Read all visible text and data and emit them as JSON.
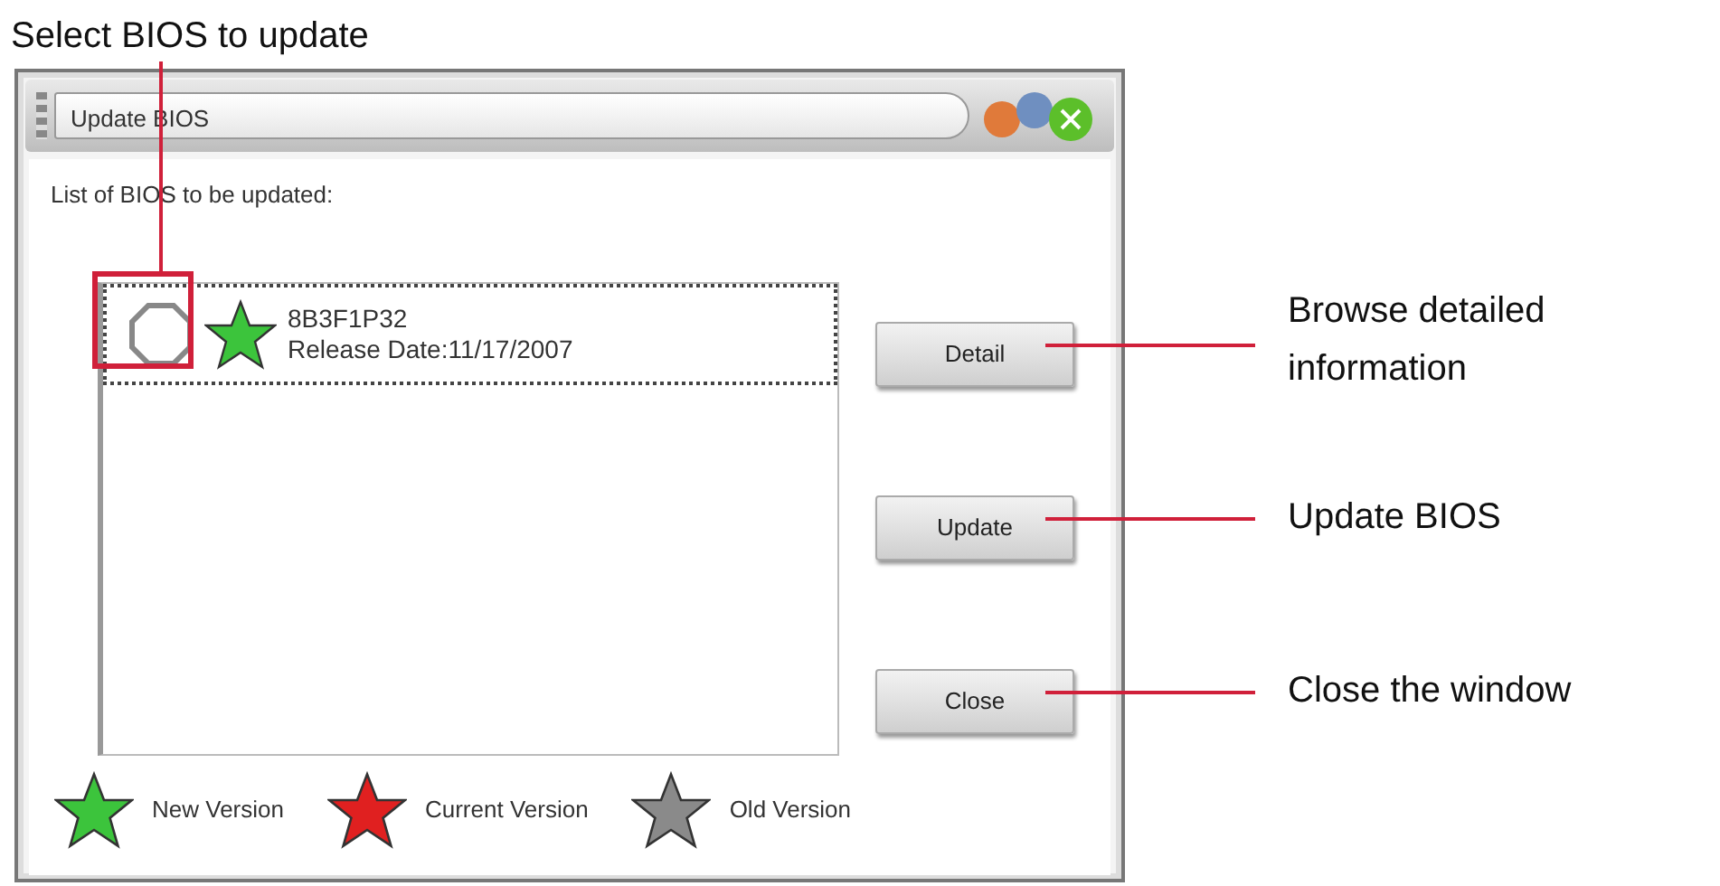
{
  "callouts": [
    {
      "text": "Select BIOS to update",
      "kind": "top"
    },
    {
      "text": "Browse detailed information",
      "kind": "side"
    },
    {
      "text": "Update BIOS",
      "kind": "side"
    },
    {
      "text": "Close the window",
      "kind": "side"
    }
  ],
  "window": {
    "title": "Update BIOS",
    "list_label": "List of BIOS to be updated:",
    "items": [
      {
        "name": "8B3F1P32",
        "release_date": "Release Date:11/17/2007",
        "kind": "new",
        "selected": false
      }
    ],
    "buttons": [
      "Detail",
      "Update",
      "Close"
    ],
    "legend": [
      {
        "label": "New Version",
        "color": "#3cc43c"
      },
      {
        "label": "Current Version",
        "color": "#e02020"
      },
      {
        "label": "Old Version",
        "color": "#8a8a8a"
      }
    ]
  }
}
